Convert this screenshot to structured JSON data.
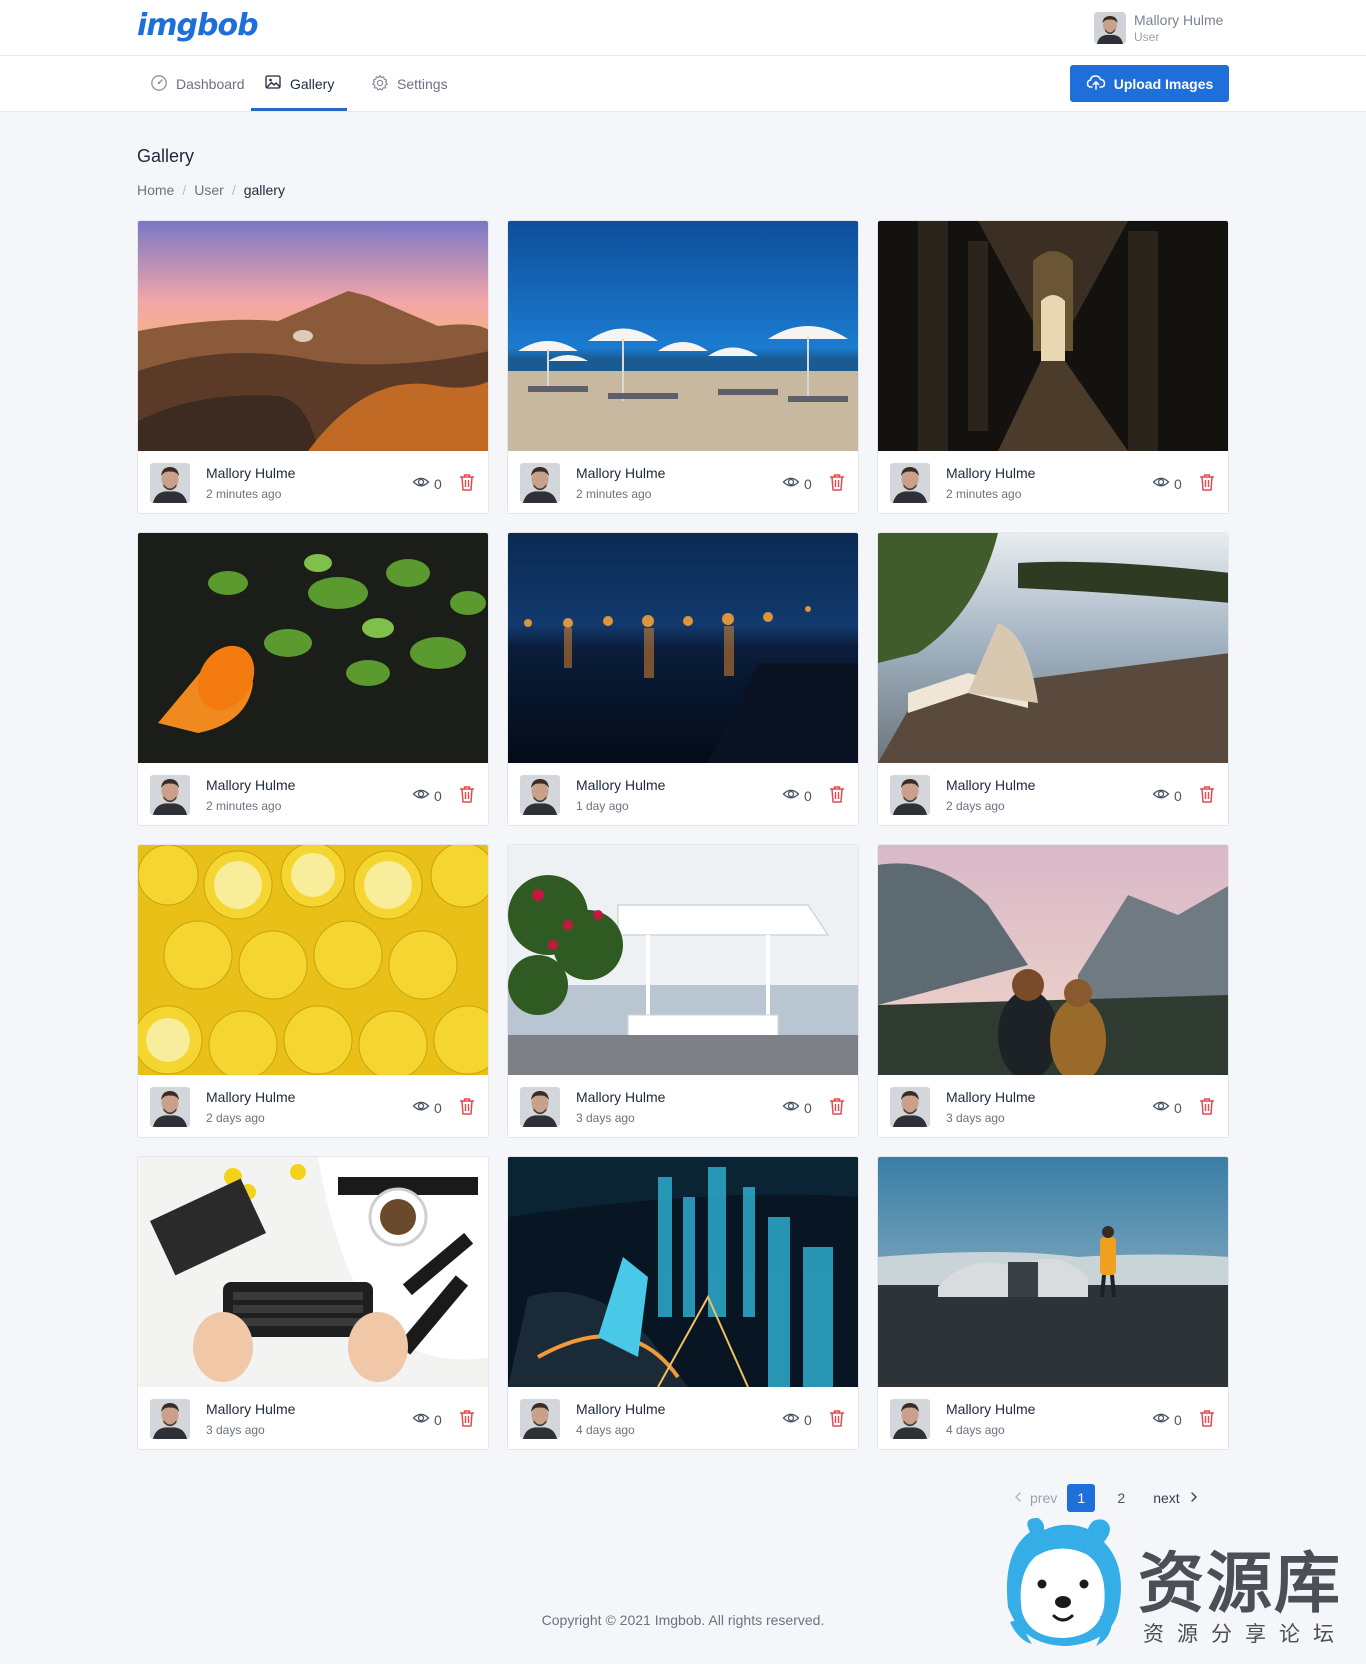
{
  "header": {
    "logo": "imgbob",
    "user_name": "Mallory Hulme",
    "user_role": "User"
  },
  "nav": {
    "items": [
      {
        "label": "Dashboard",
        "icon": "gauge-icon",
        "active": false
      },
      {
        "label": "Gallery",
        "icon": "image-icon",
        "active": true
      },
      {
        "label": "Settings",
        "icon": "gear-icon",
        "active": false
      }
    ],
    "upload_label": "Upload Images",
    "upload_icon": "cloud-upload-icon"
  },
  "page": {
    "title": "Gallery",
    "breadcrumb": [
      "Home",
      "User",
      "gallery"
    ]
  },
  "cards": [
    {
      "author": "Mallory Hulme",
      "time": "2 minutes ago",
      "views": "0",
      "photo": "volcano-sunset"
    },
    {
      "author": "Mallory Hulme",
      "time": "2 minutes ago",
      "views": "0",
      "photo": "beach-umbrellas"
    },
    {
      "author": "Mallory Hulme",
      "time": "2 minutes ago",
      "views": "0",
      "photo": "arcade-corridor"
    },
    {
      "author": "Mallory Hulme",
      "time": "2 minutes ago",
      "views": "0",
      "photo": "watering-can-plants"
    },
    {
      "author": "Mallory Hulme",
      "time": "1 day ago",
      "views": "0",
      "photo": "night-harbor-lights"
    },
    {
      "author": "Mallory Hulme",
      "time": "2 days ago",
      "views": "0",
      "photo": "open-book-lake"
    },
    {
      "author": "Mallory Hulme",
      "time": "2 days ago",
      "views": "0",
      "photo": "lemons"
    },
    {
      "author": "Mallory Hulme",
      "time": "3 days ago",
      "views": "0",
      "photo": "seaside-cafe"
    },
    {
      "author": "Mallory Hulme",
      "time": "3 days ago",
      "views": "0",
      "photo": "mountain-valley-couple"
    },
    {
      "author": "Mallory Hulme",
      "time": "3 days ago",
      "views": "0",
      "photo": "desk-keyboard"
    },
    {
      "author": "Mallory Hulme",
      "time": "4 days ago",
      "views": "0",
      "photo": "night-city-aerial"
    },
    {
      "author": "Mallory Hulme",
      "time": "4 days ago",
      "views": "0",
      "photo": "plane-wreck-beach"
    }
  ],
  "pagination": {
    "prev": "prev",
    "pages": [
      "1",
      "2"
    ],
    "current": "1",
    "next": "next"
  },
  "footer": {
    "copyright": "Copyright © 2021 Imgbob. All rights reserved."
  },
  "watermark": {
    "title": "资源库",
    "subtitle": "资源分享论坛"
  },
  "colors": {
    "accent": "#1e6fd9",
    "delete": "#e5484d",
    "background": "#f4f6fa"
  }
}
